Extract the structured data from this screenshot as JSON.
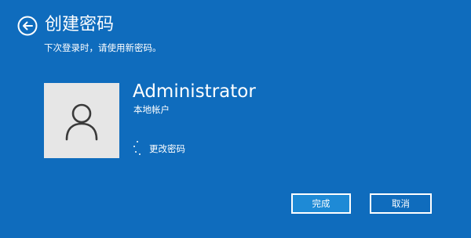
{
  "header": {
    "title": "创建密码",
    "subtitle": "下次登录时，请使用新密码。",
    "back_icon": "back-arrow-icon"
  },
  "account": {
    "username": "Administrator",
    "account_type": "本地帐户",
    "avatar_icon": "user-icon"
  },
  "status": {
    "text": "更改密码",
    "icon": "spinner-icon"
  },
  "buttons": {
    "finish_label": "完成",
    "cancel_label": "取消"
  },
  "colors": {
    "background": "#0f6cbd",
    "primary_button": "#1e8ad6",
    "avatar_bg": "#e6e6e6",
    "text": "#ffffff"
  }
}
